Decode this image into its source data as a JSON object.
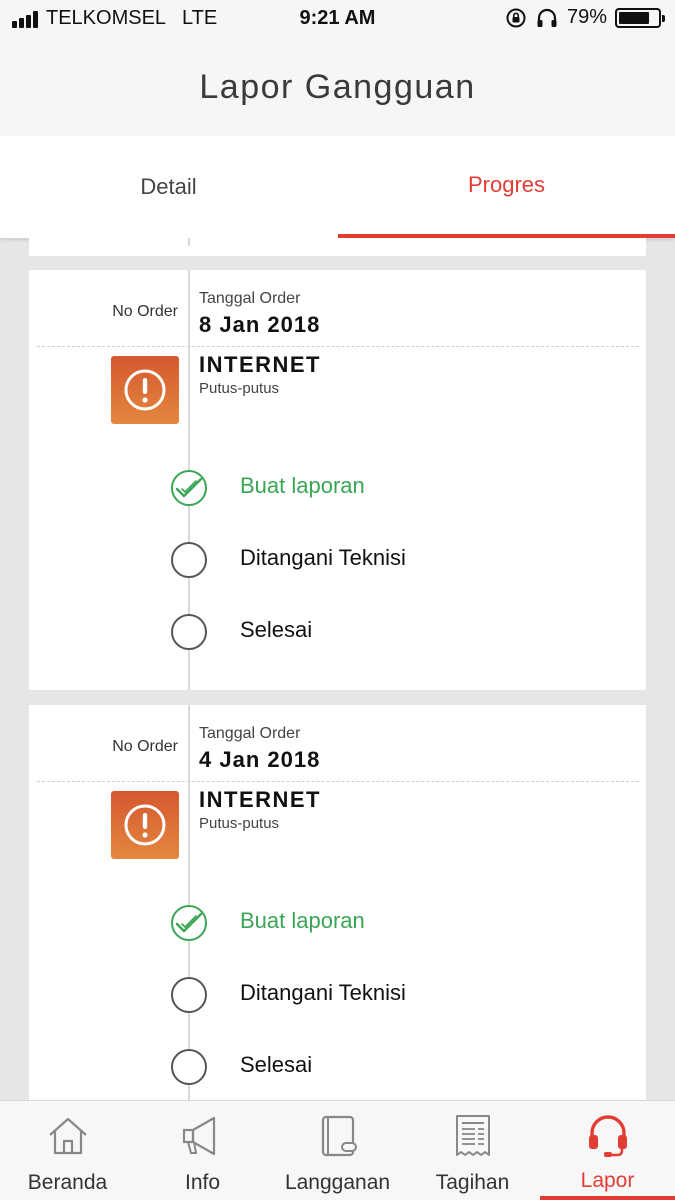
{
  "status_bar": {
    "carrier": "TELKOMSEL",
    "network": "LTE",
    "time": "9:21 AM",
    "battery": "79%",
    "battery_level": 0.79
  },
  "header": {
    "title": "Lapor Gangguan"
  },
  "tabs": [
    {
      "label": "Detail",
      "active": false
    },
    {
      "label": "Progres",
      "active": true
    }
  ],
  "orders": [
    {
      "no_order_label": "No Order",
      "date_label": "Tanggal Order",
      "date": "8 Jan 2018",
      "service": "INTERNET",
      "issue": "Putus-putus",
      "icon": "alert-circle-icon",
      "steps": [
        {
          "label": "Buat laporan",
          "status": "done"
        },
        {
          "label": "Ditangani Teknisi",
          "status": "pending"
        },
        {
          "label": "Selesai",
          "status": "pending"
        }
      ]
    },
    {
      "no_order_label": "No Order",
      "date_label": "Tanggal Order",
      "date": "4 Jan 2018",
      "service": "INTERNET",
      "issue": "Putus-putus",
      "icon": "alert-circle-icon",
      "steps": [
        {
          "label": "Buat laporan",
          "status": "done"
        },
        {
          "label": "Ditangani Teknisi",
          "status": "pending"
        },
        {
          "label": "Selesai",
          "status": "pending"
        }
      ]
    }
  ],
  "bottom_nav": [
    {
      "label": "Beranda",
      "icon": "home-icon",
      "active": false
    },
    {
      "label": "Info",
      "icon": "megaphone-icon",
      "active": false
    },
    {
      "label": "Langganan",
      "icon": "book-icon",
      "active": false
    },
    {
      "label": "Tagihan",
      "icon": "receipt-icon",
      "active": false
    },
    {
      "label": "Lapor",
      "icon": "headset-icon",
      "active": true
    }
  ],
  "colors": {
    "accent": "#e23d35",
    "done": "#3aa655",
    "alert_top": "#d4582f",
    "alert_bottom": "#e4873f"
  }
}
